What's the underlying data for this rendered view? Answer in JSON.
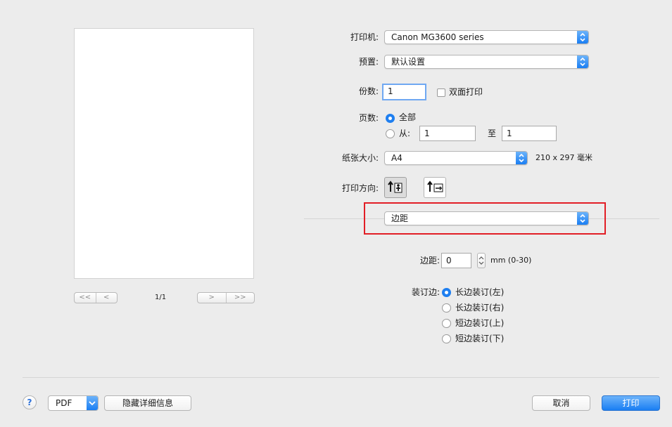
{
  "preview": {
    "page_indicator": "1/1",
    "first": "<<",
    "prev": "<",
    "next": ">",
    "last": ">>"
  },
  "printer": {
    "label": "打印机:",
    "value": "Canon MG3600 series"
  },
  "presets": {
    "label": "预置:",
    "value": "默认设置"
  },
  "copies": {
    "label": "份数:",
    "value": "1",
    "duplex_label": "双面打印"
  },
  "pages": {
    "label": "页数:",
    "all": "全部",
    "from": "从:",
    "from_value": "1",
    "to": "至",
    "to_value": "1"
  },
  "paper_size": {
    "label": "纸张大小:",
    "value": "A4",
    "dimensions": "210 x 297 毫米"
  },
  "orientation": {
    "label": "打印方向:"
  },
  "section": {
    "value": "边距"
  },
  "margin": {
    "label": "边距:",
    "value": "0",
    "range": "mm (0-30)"
  },
  "binding": {
    "label": "装订边:",
    "options": [
      "长边装订(左)",
      "长边装订(右)",
      "短边装订(上)",
      "短边装订(下)"
    ]
  },
  "footer": {
    "help": "?",
    "pdf": "PDF",
    "hide_details": "隐藏详细信息",
    "cancel": "取消",
    "print": "打印"
  },
  "colors": {
    "accent": "#1f7ff0",
    "highlight": "#e21e26"
  }
}
